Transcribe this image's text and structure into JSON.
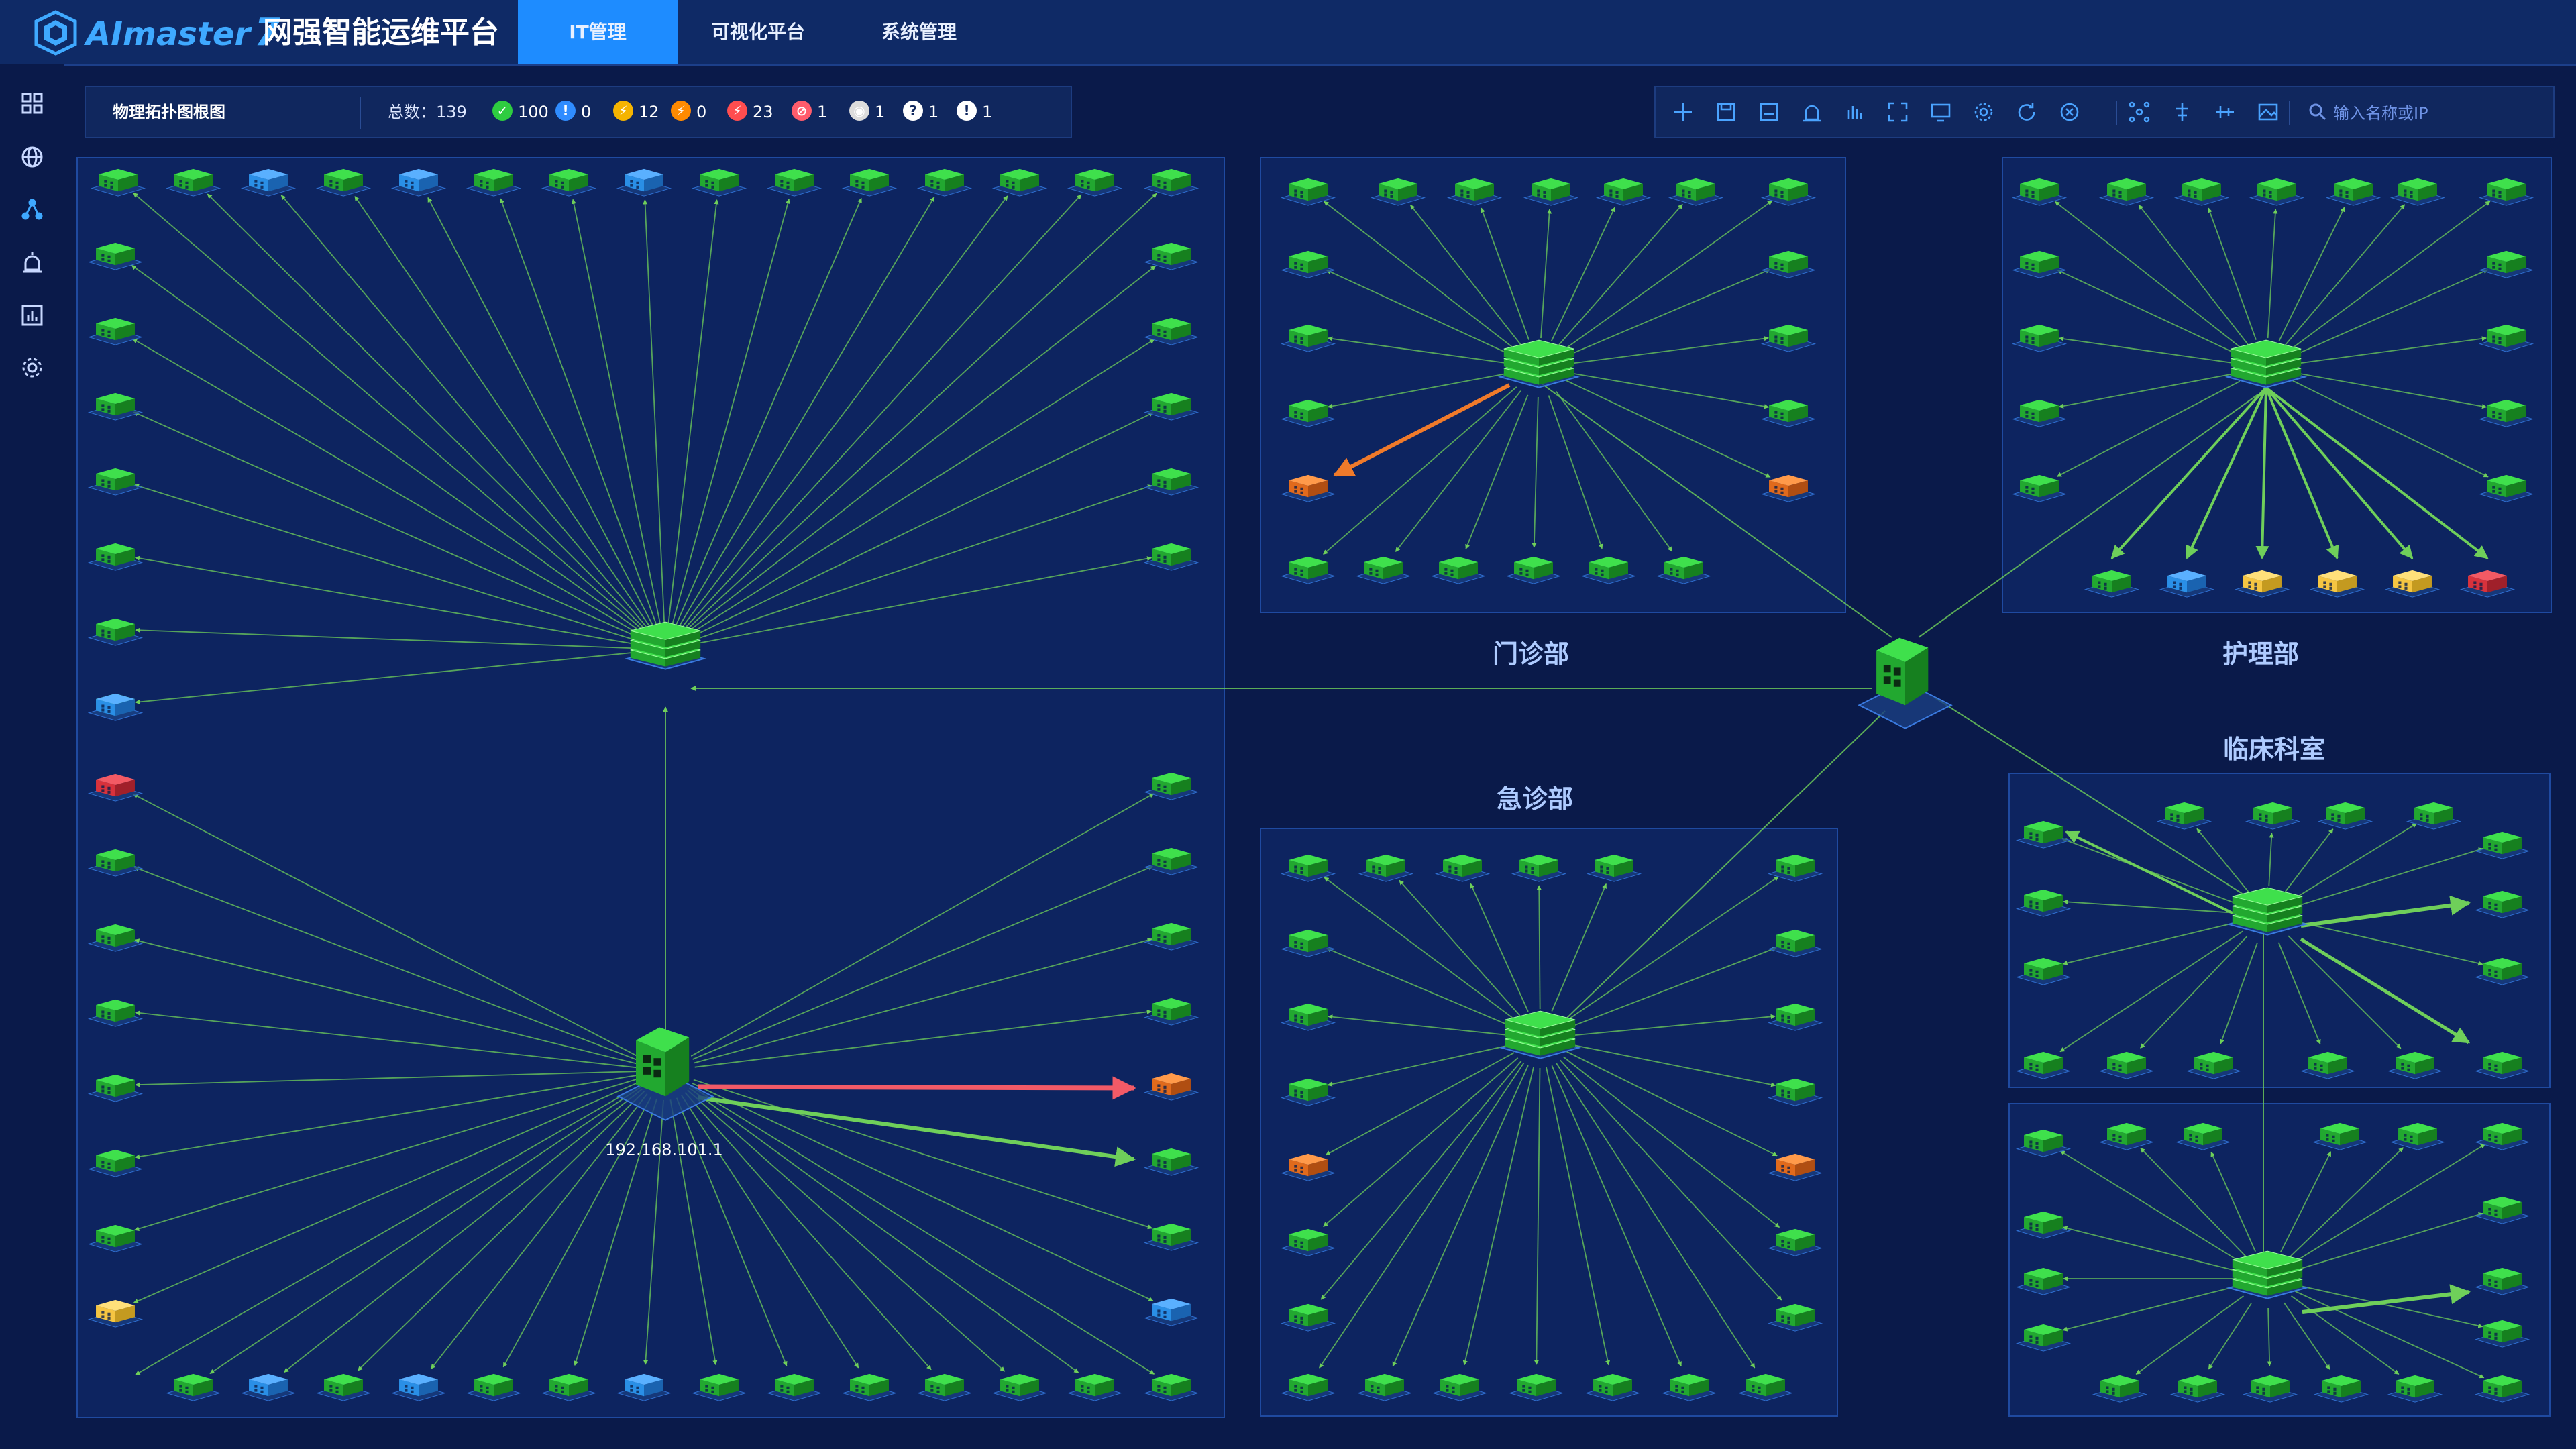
{
  "header": {
    "brand": "AImaster",
    "brand_version": "7",
    "platform_title": "网强智能运维平台",
    "nav": [
      {
        "label": "IT管理",
        "active": true
      },
      {
        "label": "可视化平台",
        "active": false
      },
      {
        "label": "系统管理",
        "active": false
      }
    ]
  },
  "sidebar": {
    "icons": [
      "grid-icon",
      "globe-icon",
      "topology-icon",
      "alarm-icon",
      "report-icon",
      "settings-icon"
    ]
  },
  "infobar": {
    "map_name": "物理拓扑图根图",
    "total_label": "总数：139",
    "stats": [
      {
        "icon": "ok-icon",
        "color": "#2ecc40",
        "glyph": "✓",
        "value": "100"
      },
      {
        "icon": "info-icon",
        "color": "#2f8cff",
        "glyph": "!",
        "value": "0"
      },
      {
        "icon": "warning-icon",
        "color": "#f5b400",
        "glyph": "⚡",
        "value": "12"
      },
      {
        "icon": "minor-icon",
        "color": "#ff8a00",
        "glyph": "⚡",
        "value": "0"
      },
      {
        "icon": "major-icon",
        "color": "#ff4d4f",
        "glyph": "⚡",
        "value": "23"
      },
      {
        "icon": "critical-icon",
        "color": "#ff5c6c",
        "glyph": "⊘",
        "value": "1"
      },
      {
        "icon": "unmanaged-icon",
        "color": "#dcdcdc",
        "glyph": "◉",
        "value": "1"
      },
      {
        "icon": "unknown-icon",
        "color": "#ffffff",
        "glyph": "?",
        "value": "1"
      },
      {
        "icon": "alert-icon",
        "color": "#ffffff",
        "glyph": "!",
        "value": "1"
      }
    ]
  },
  "toolbar": {
    "tools": [
      "add-icon",
      "save-icon",
      "save-as-icon",
      "alarm-icon",
      "chart-icon",
      "fullscreen-icon",
      "monitor-icon",
      "settings-icon",
      "refresh-icon",
      "close-icon",
      "layout-icon",
      "align-icon",
      "distribute-icon",
      "image-icon"
    ],
    "search_placeholder": "输入名称或IP"
  },
  "regions": {
    "outpatient": "门诊部",
    "nursing": "护理部",
    "emergency": "急诊部",
    "clinical": "临床科室"
  },
  "core_switch_ip": "192.168.101.1",
  "colors": {
    "node_green": "#2fc83c",
    "node_orange": "#f07a2a",
    "node_blue": "#2a8fe6",
    "node_red": "#d8323c",
    "node_yellow": "#f5c542",
    "link": "#6fcf5a",
    "alert_link": "#f25a67",
    "warn_link": "#f07a2a"
  }
}
